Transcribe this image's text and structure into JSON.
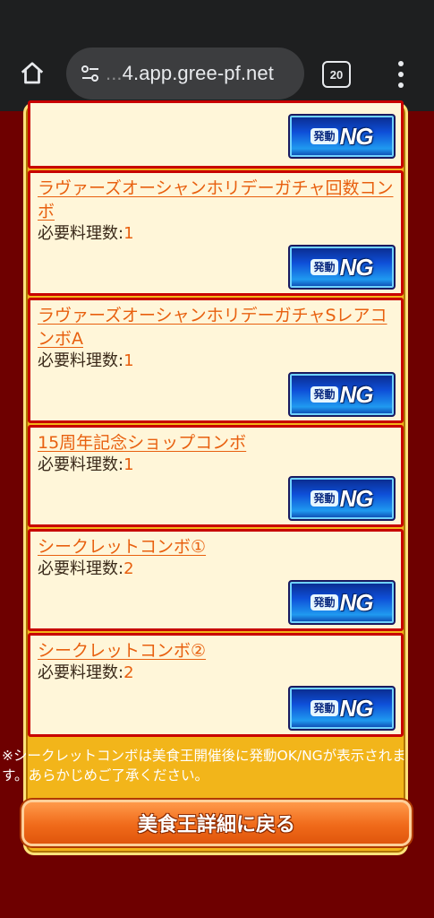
{
  "browser": {
    "url_fade": "...",
    "url_text": "4.app.gree-pf.net",
    "tab_count": "20",
    "icons": [
      "home-icon",
      "site-settings-icon",
      "tabs-icon",
      "more-menu-icon"
    ]
  },
  "combos": [
    {
      "title": "",
      "required_label": "",
      "required_value": "",
      "button_small": "発動",
      "button_big": "NG"
    },
    {
      "title": "ラヴァーズオーシャンホリデーガチャ回数コンボ",
      "required_label": "必要料理数:",
      "required_value": "1",
      "button_small": "発動",
      "button_big": "NG"
    },
    {
      "title": "ラヴァーズオーシャンホリデーガチャSレアコンボA",
      "required_label": "必要料理数:",
      "required_value": "1",
      "button_small": "発動",
      "button_big": "NG"
    },
    {
      "title": "15周年記念ショップコンボ",
      "required_label": "必要料理数:",
      "required_value": "1",
      "button_small": "発動",
      "button_big": "NG"
    },
    {
      "title": "シークレットコンボ①",
      "required_label": "必要料理数:",
      "required_value": "2",
      "button_small": "発動",
      "button_big": "NG"
    },
    {
      "title": "シークレットコンボ②",
      "required_label": "必要料理数:",
      "required_value": "2",
      "button_small": "発動",
      "button_big": "NG"
    }
  ],
  "note": "※シークレットコンボは美食王開催後に発動OK/NGが表示されます。あらかじめご了承ください。",
  "back_button": "美食王詳細に戻る",
  "colors": {
    "page_bg": "#6e0000",
    "frame": "#f2b51a",
    "item_bg": "#fff6d9",
    "item_border": "#c80000",
    "link": "#e8600f",
    "button_orange": "#f06a1a"
  }
}
